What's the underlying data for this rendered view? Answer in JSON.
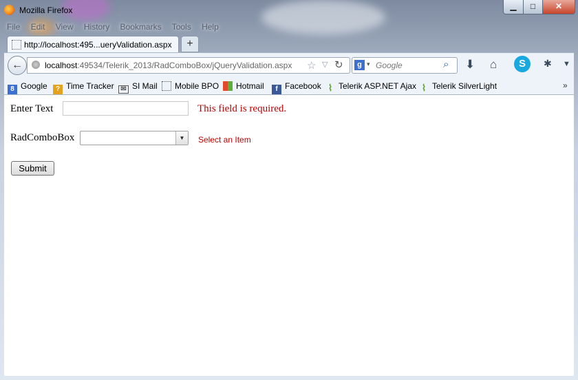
{
  "window": {
    "title": "Mozilla Firefox"
  },
  "menubar": {
    "items": [
      "File",
      "Edit",
      "View",
      "History",
      "Bookmarks",
      "Tools",
      "Help"
    ]
  },
  "tabs": [
    {
      "label": "http://localhost:495...ueryValidation.aspx"
    }
  ],
  "new_tab_label": "+",
  "navbar": {
    "url_host": "localhost",
    "url_path": ":49534/Telerik_2013/RadComboBox/jQueryValidation.aspx",
    "search_engine": "Google",
    "search_placeholder": "Google"
  },
  "bookmarks": [
    {
      "label": "Google",
      "icon": "google-icon",
      "color": "#3b6fd1"
    },
    {
      "label": "Time Tracker",
      "icon": "time-tracker-icon",
      "color": "#e6a21a"
    },
    {
      "label": "SI Mail",
      "icon": "mail-icon",
      "color": "#7a7a7a"
    },
    {
      "label": "Mobile BPO",
      "icon": "page-icon",
      "color": "#ffffff"
    },
    {
      "label": "Hotmail",
      "icon": "windows-icon",
      "color": "#e34a2b"
    },
    {
      "label": "Facebook",
      "icon": "facebook-icon",
      "color": "#3b5998"
    },
    {
      "label": "Telerik ASP.NET Ajax",
      "icon": "telerik-icon",
      "color": "#5aa02c"
    },
    {
      "label": "Telerik SilverLight",
      "icon": "telerik-icon",
      "color": "#5aa02c"
    }
  ],
  "form": {
    "enter_text_label": "Enter Text",
    "text_value": "",
    "required_error": "This field is required.",
    "combo_label": "RadComboBox",
    "combo_value": "",
    "combo_error": "Select an Item",
    "submit_label": "Submit"
  },
  "colors": {
    "error": "#c00000",
    "chrome": "#eef3f9"
  }
}
